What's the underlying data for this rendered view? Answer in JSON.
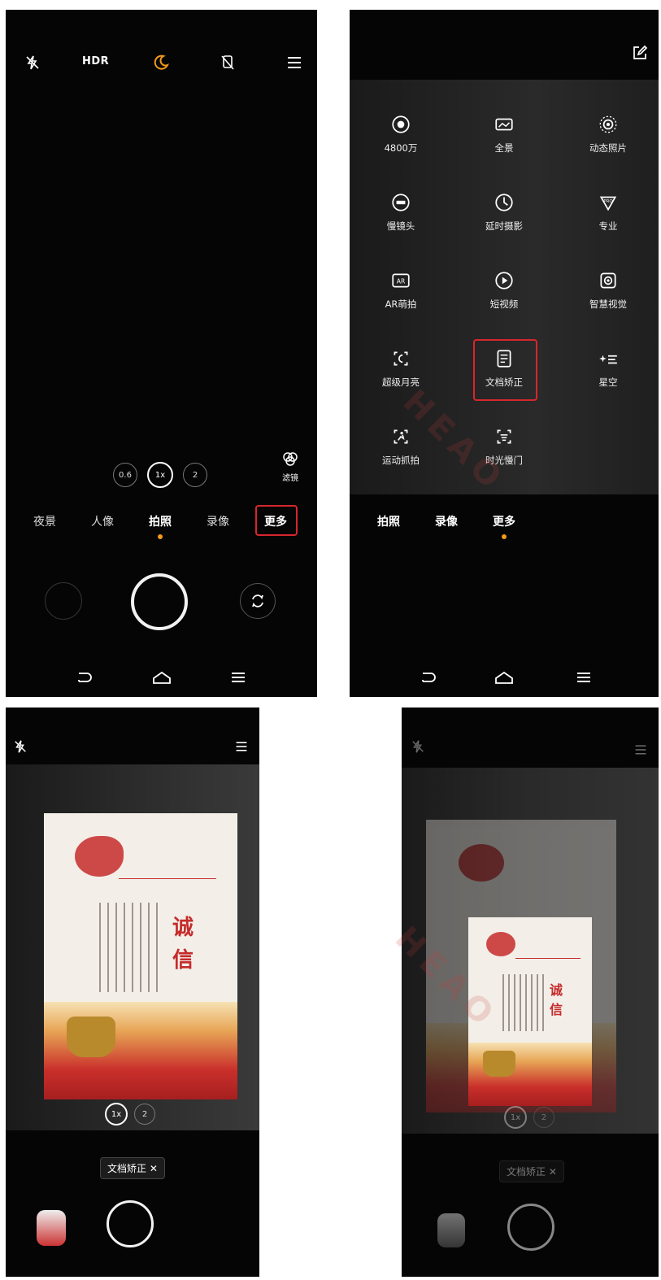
{
  "screen1": {
    "topbar": {
      "hdr_label": "HDR"
    },
    "zoom_levels": [
      "0.6",
      "1x",
      "2"
    ],
    "filter_label": "滤镜",
    "modes": [
      "夜景",
      "人像",
      "拍照",
      "录像",
      "更多"
    ],
    "selected_mode": "拍照",
    "highlighted_mode": "更多"
  },
  "screen2": {
    "grid": [
      {
        "label": "4800万",
        "icon": "aperture-icon"
      },
      {
        "label": "全景",
        "icon": "panorama-icon"
      },
      {
        "label": "动态照片",
        "icon": "live-photo-icon"
      },
      {
        "label": "慢镜头",
        "icon": "slow-motion-icon"
      },
      {
        "label": "延时摄影",
        "icon": "timelapse-icon"
      },
      {
        "label": "专业",
        "icon": "pro-icon"
      },
      {
        "label": "AR萌拍",
        "icon": "ar-icon"
      },
      {
        "label": "短视频",
        "icon": "short-video-icon"
      },
      {
        "label": "智慧视觉",
        "icon": "smart-vision-icon"
      },
      {
        "label": "超级月亮",
        "icon": "super-moon-icon"
      },
      {
        "label": "文档矫正",
        "icon": "document-icon"
      },
      {
        "label": "星空",
        "icon": "starry-sky-icon"
      },
      {
        "label": "运动抓拍",
        "icon": "sport-capture-icon"
      },
      {
        "label": "时光慢门",
        "icon": "slow-shutter-icon"
      }
    ],
    "highlighted_item": "文档矫正",
    "modes": [
      "拍照",
      "录像",
      "更多"
    ],
    "selected_mode": "更多"
  },
  "screen3": {
    "zoom_levels": [
      "1x",
      "2"
    ],
    "chip_label": "文档矫正 ✕",
    "document": {
      "title_chars": [
        "诚",
        "信"
      ]
    }
  },
  "screen4": {
    "zoom_levels": [
      "1x",
      "2"
    ],
    "chip_label": "文档矫正 ✕",
    "document": {
      "title_chars": [
        "诚",
        "信"
      ]
    }
  },
  "watermark": {
    "text": "HEAO"
  },
  "colors": {
    "accent": "#f39a1a",
    "highlight": "#d8262d",
    "background": "#050505"
  }
}
